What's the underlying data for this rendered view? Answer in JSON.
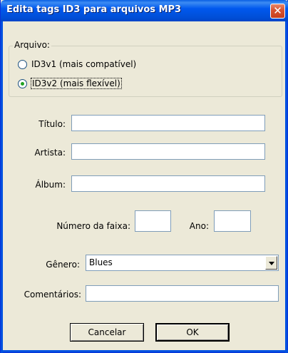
{
  "window": {
    "title": "Edita tags ID3 para arquivos MP3",
    "close_glyph": "✕"
  },
  "file_group": {
    "legend": "Arquivo:",
    "options": [
      {
        "label": "ID3v1 (mais compatível)",
        "checked": false
      },
      {
        "label": "ID3v2 (mais flexível)",
        "checked": true
      }
    ]
  },
  "fields": {
    "title_label": "Título:",
    "title_value": "",
    "artist_label": "Artista:",
    "artist_value": "",
    "album_label": "Álbum:",
    "album_value": "",
    "track_label": "Número da faixa:",
    "track_value": "",
    "year_label": "Ano:",
    "year_value": "",
    "genre_label": "Gênero:",
    "genre_value": "Blues",
    "comments_label": "Comentários:",
    "comments_value": ""
  },
  "buttons": {
    "cancel_label": "Cancelar",
    "ok_label": "OK"
  }
}
